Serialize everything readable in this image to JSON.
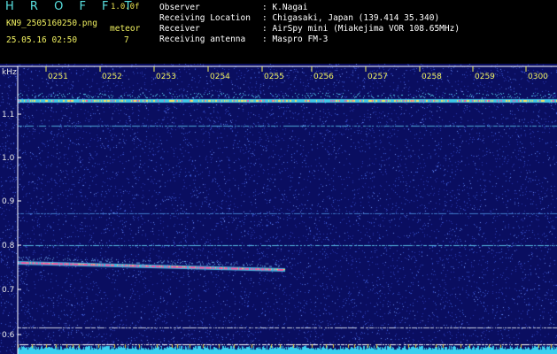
{
  "header": {
    "brand": "H R O F F T",
    "version": "1.0.0f",
    "filename": "KN9_2505160250.png",
    "datetime": "25.05.16 02:50",
    "meteor_label": "meteor",
    "meteor_count": "7",
    "info": [
      {
        "label": "Observer",
        "value": ": K.Nagai"
      },
      {
        "label": "Receiving Location",
        "value": ": Chigasaki, Japan (139.414 35.340)"
      },
      {
        "label": "Receiver",
        "value": ": AirSpy mini (Miakejima VOR 108.65MHz)"
      },
      {
        "label": "Receiving antenna",
        "value": ": Maspro FM-3"
      }
    ]
  },
  "spectrogram": {
    "unit_label": "kHz",
    "freq_ticks": [
      "1.1",
      "1.0",
      "0.9",
      "0.8",
      "0.7",
      "0.6"
    ],
    "time_ticks": [
      "0251",
      "0252",
      "0253",
      "0254",
      "0255",
      "0256",
      "0257",
      "0258",
      "0259",
      "0300"
    ],
    "background_color": "#0a0e60",
    "signal_color": "#ff4fa0",
    "trace_color": "#55d0e0"
  }
}
